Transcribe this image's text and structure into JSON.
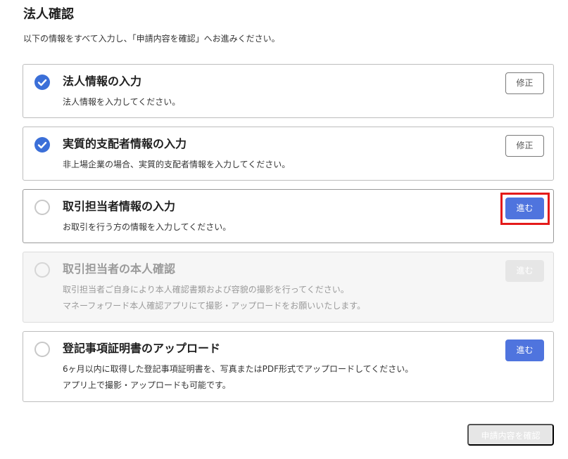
{
  "page": {
    "title": "法人確認",
    "description": "以下の情報をすべて入力し、「申請内容を確認」へお進みください。"
  },
  "steps": [
    {
      "title": "法人情報の入力",
      "desc_lines": [
        "法人情報を入力してください。"
      ],
      "status": "done",
      "button_label": "修正"
    },
    {
      "title": "実質的支配者情報の入力",
      "desc_lines": [
        "非上場企業の場合、実質的支配者情報を入力してください。"
      ],
      "status": "done",
      "button_label": "修正"
    },
    {
      "title": "取引担当者情報の入力",
      "desc_lines": [
        "お取引を行う方の情報を入力してください。"
      ],
      "status": "todo",
      "button_label": "進む"
    },
    {
      "title": "取引担当者の本人確認",
      "desc_lines": [
        "取引担当者ご自身により本人確認書類および容貌の撮影を行ってください。",
        "マネーフォワード本人確認アプリにて撮影・アップロードをお願いいたします。"
      ],
      "status": "disabled",
      "button_label": "進む"
    },
    {
      "title": "登記事項証明書のアップロード",
      "desc_lines": [
        "6ヶ月以内に取得した登記事項証明書を、写真またはPDF形式でアップロードしてください。",
        "アプリ上で撮影・アップロードも可能です。"
      ],
      "status": "todo",
      "button_label": "進む"
    }
  ],
  "footer": {
    "confirm_label": "申請内容を確認"
  },
  "colors": {
    "primary": "#4f74de",
    "check": "#3b6fd8",
    "highlight": "#e41a1a"
  }
}
